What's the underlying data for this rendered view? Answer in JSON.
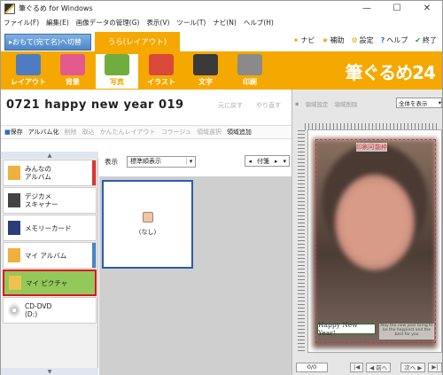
{
  "window": {
    "title": "筆ぐるめ for Windows",
    "minimize": "—",
    "maximize": "☐",
    "close": "✕"
  },
  "menu": [
    "ファイル(F)",
    "編集(E)",
    "画像データの管理(G)",
    "表示(V)",
    "ツール(T)",
    "ナビ(N)",
    "ヘルプ(H)"
  ],
  "mode": {
    "omote": "▸おもて(宛て名)へ切替",
    "ura": "うら(レイアウト)"
  },
  "top_actions": [
    {
      "icon": "✦",
      "label": "ナビ"
    },
    {
      "icon": "★",
      "label": "補助"
    },
    {
      "icon": "⚙",
      "label": "設定"
    },
    {
      "icon": "?",
      "label": "ヘルプ"
    },
    {
      "icon": "✔",
      "label": "終了"
    }
  ],
  "categories": [
    {
      "label": "レイアウト",
      "color": "#4f7cc0"
    },
    {
      "label": "背景",
      "color": "#e35a8c"
    },
    {
      "label": "写真",
      "color": "#6fae3e"
    },
    {
      "label": "イラスト",
      "color": "#d94a3b"
    },
    {
      "label": "文字",
      "color": "#3a3a3a"
    },
    {
      "label": "印刷",
      "color": "#8a8a8a"
    }
  ],
  "brand": "筆ぐるめ24",
  "document": {
    "title": "0721 happy new year 019",
    "undo": "元に戻す",
    "redo": "やり直す"
  },
  "toolbar": [
    {
      "label": "保存",
      "dis": false
    },
    {
      "label": "アルバム化",
      "dis": false
    },
    {
      "label": "削除",
      "dis": true
    },
    {
      "label": "取込",
      "dis": true
    },
    {
      "label": "かんたんレイアウト",
      "dis": true
    },
    {
      "label": "コラージュ",
      "dis": true
    },
    {
      "label": "領域選択",
      "dis": true
    },
    {
      "label": "領域追加",
      "dis": false
    }
  ],
  "sidebar": [
    {
      "label": "みんなの\nアルバム",
      "tab": "#d33"
    },
    {
      "label": "デジカメ\nスキャナー",
      "tab": ""
    },
    {
      "label": "メモリーカード",
      "tab": ""
    },
    {
      "label": "マイ アルバム",
      "tab": "#4a86d0"
    },
    {
      "label": "マイ ピクチャ",
      "tab": ""
    },
    {
      "label": "CD-DVD\n(D:)",
      "tab": ""
    }
  ],
  "content": {
    "view_label": "表示",
    "view_value": "標準順表示",
    "fusen": "付箋",
    "thumb_label": "(なし)"
  },
  "preview": {
    "tools": [
      "領域設定",
      "領域削除"
    ],
    "view_select": "全体を表示",
    "print_area": "印刷可能枠",
    "card_text": "Happy New Year!",
    "card_msg": "May the new year bring to be the happiest and the best for you",
    "page": "0/0",
    "prev": "◀ 前へ",
    "next": "次へ ▶"
  }
}
